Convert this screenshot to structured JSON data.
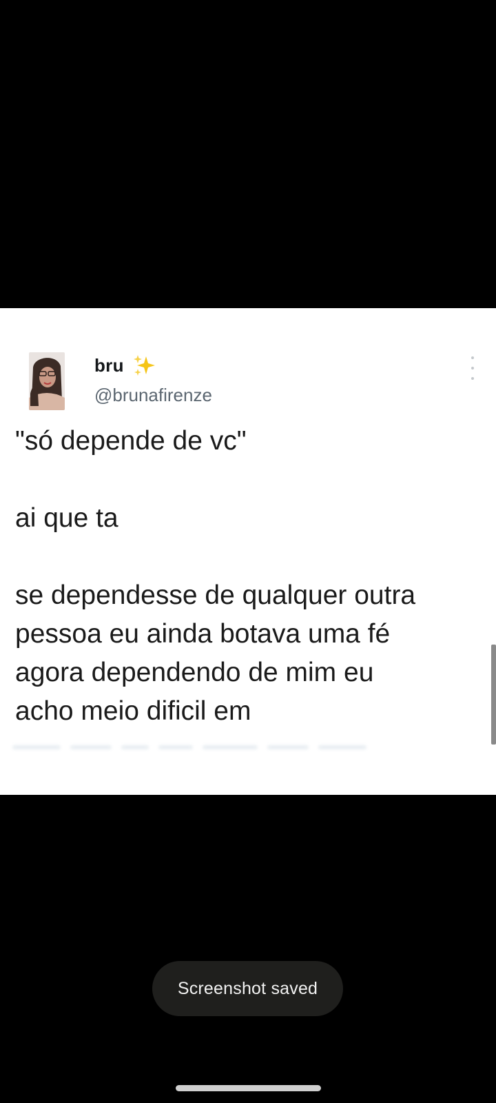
{
  "tweet": {
    "display_name": "bru",
    "emoji_icon": "sparkles-icon",
    "handle": "@brunafirenze",
    "text_lines": [
      "\"só depende de vc\"",
      "",
      "ai que ta",
      "",
      "se dependesse de qualquer outra",
      "pessoa eu ainda botava uma fé",
      "agora dependendo de mim eu",
      "acho meio dificil em"
    ],
    "more_icon": "more-vertical-icon"
  },
  "toast": {
    "message": "Screenshot saved"
  },
  "colors": {
    "background": "#000000",
    "card": "#ffffff",
    "text": "#1a1a1a",
    "handle": "#5b6670",
    "sparkle": "#f5c518",
    "toast_bg": "#1f1f1d",
    "toast_text": "#f2f2f2"
  }
}
